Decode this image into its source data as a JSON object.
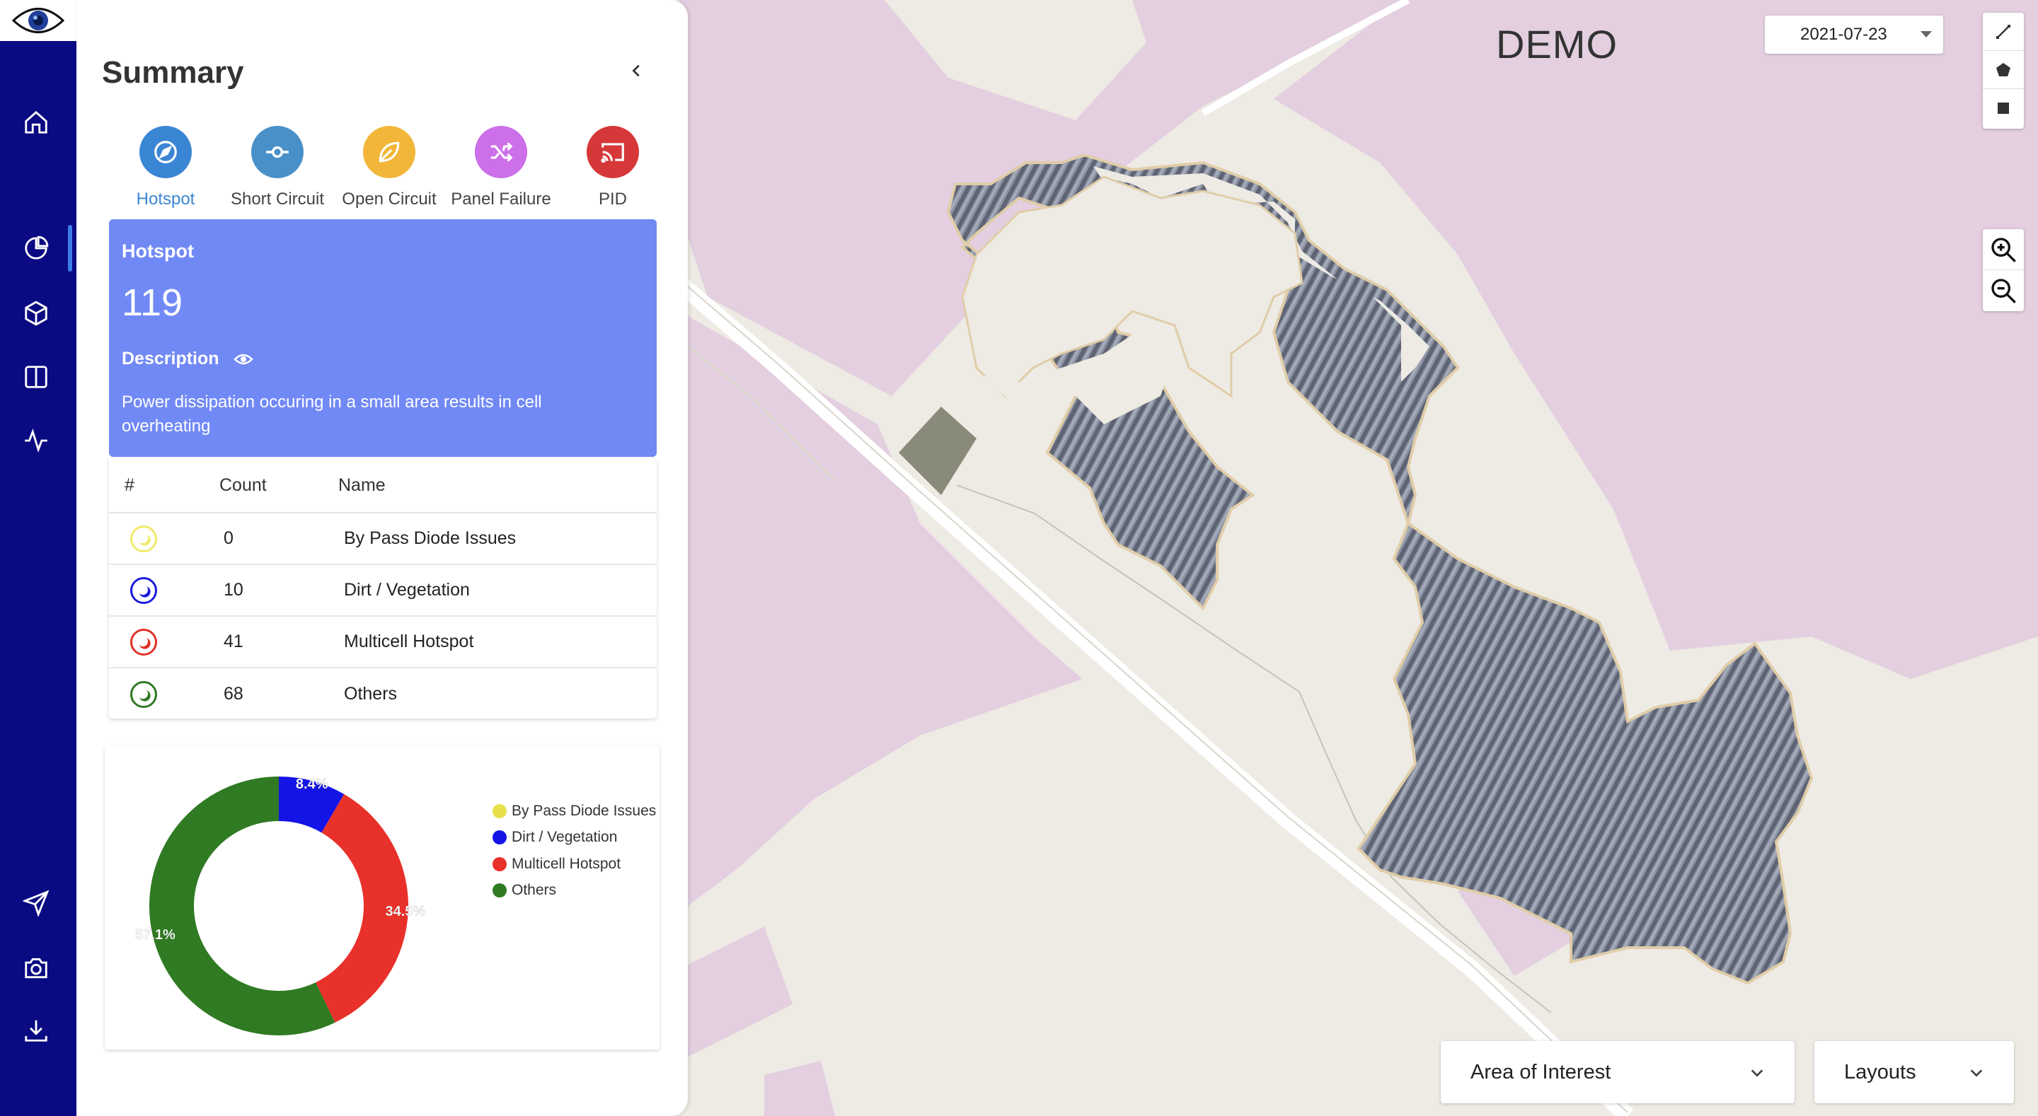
{
  "colors": {
    "nav_bg": "#0a0a82",
    "card_bg": "#7189f5",
    "land_purple": "#e3cfe0",
    "map_bg": "#eeeae4"
  },
  "nav": {
    "items": [
      {
        "name": "home-icon"
      },
      {
        "name": "pie-chart-icon"
      },
      {
        "name": "cube-icon"
      },
      {
        "name": "panel-layout-icon"
      },
      {
        "name": "pulse-icon"
      },
      {
        "name": "send-icon"
      },
      {
        "name": "camera-icon"
      },
      {
        "name": "download-icon"
      }
    ]
  },
  "summary": {
    "title": "Summary",
    "issue_types": [
      {
        "label": "Hotspot",
        "color": "#3a86d4",
        "icon": "compass-icon"
      },
      {
        "label": "Short Circuit",
        "color": "#4a90c8",
        "icon": "short-circuit-icon"
      },
      {
        "label": "Open Circuit",
        "color": "#f2b73a",
        "icon": "leaf-icon"
      },
      {
        "label": "Panel Failure",
        "color": "#cc6fe8",
        "icon": "shuffle-icon"
      },
      {
        "label": "PID",
        "color": "#d6383a",
        "icon": "cast-icon"
      }
    ],
    "card": {
      "heading": "Hotspot",
      "count": "119",
      "description_label": "Description",
      "description": "Power dissipation occuring in a small area results in cell overheating"
    },
    "table": {
      "headers": [
        "#",
        "Count",
        "Name"
      ],
      "rows": [
        {
          "count": "0",
          "name": "By Pass Diode Issues",
          "color": "#e8e04a"
        },
        {
          "count": "10",
          "name": "Dirt / Vegetation",
          "color": "#1a1adb"
        },
        {
          "count": "41",
          "name": "Multicell Hotspot",
          "color": "#e03228"
        },
        {
          "count": "68",
          "name": "Others",
          "color": "#2f7a22"
        }
      ]
    }
  },
  "chart_data": {
    "type": "pie",
    "donut": true,
    "categories": [
      "By Pass Diode Issues",
      "Dirt / Vegetation",
      "Multicell Hotspot",
      "Others"
    ],
    "values": [
      0,
      10,
      41,
      68
    ],
    "labels": [
      "",
      "8.4%",
      "34.5%",
      "57.1%"
    ],
    "colors": [
      "#e8e04a",
      "#1414e6",
      "#e8312a",
      "#2f7a22"
    ],
    "legend_position": "right"
  },
  "map": {
    "watermark": "DEMO",
    "date": "2021-07-23",
    "area_of_interest": "Area of Interest",
    "layouts": "Layouts"
  }
}
